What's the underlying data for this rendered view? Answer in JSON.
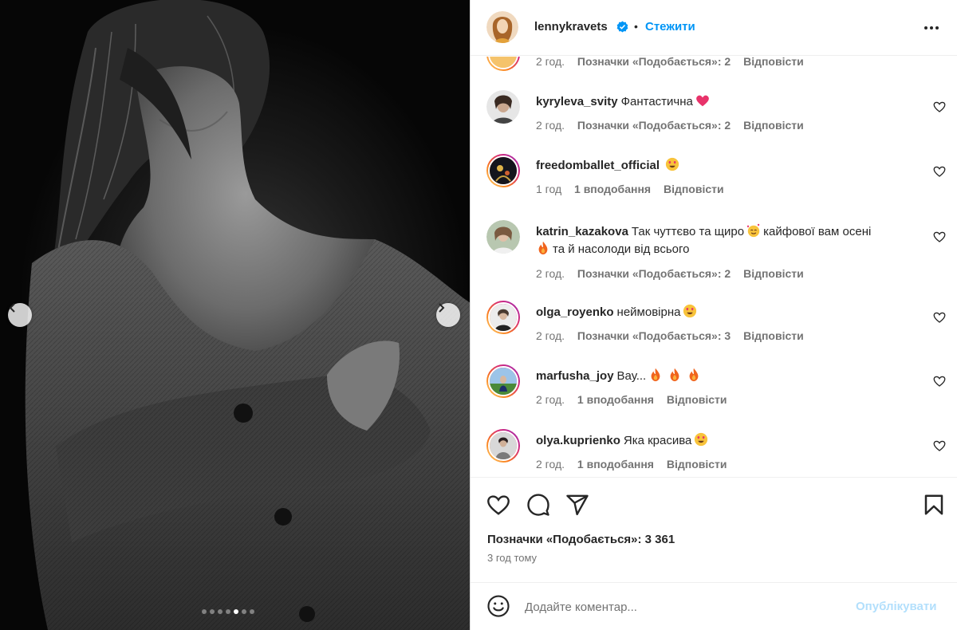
{
  "post": {
    "author": "lennykravets",
    "verified": true,
    "separator": "•",
    "follow_label": "Стежити",
    "more_icon": "more-horizontal-icon",
    "carousel": {
      "total_slides": 7,
      "active_slide": 5
    }
  },
  "comments": [
    {
      "username": "",
      "text": "",
      "time": "2 год.",
      "likes": "Позначки «Подобається»: 2",
      "reply": "Відповісти"
    },
    {
      "username": "kyryleva_svity",
      "text": "Фантастична",
      "emoji": "heart",
      "time": "2 год.",
      "likes": "Позначки «Подобається»: 2",
      "reply": "Відповісти"
    },
    {
      "username": "freedomballet_official",
      "text": "",
      "emoji": "heart-eyes",
      "time": "1 год",
      "likes": "1 вподобання",
      "reply": "Відповісти"
    },
    {
      "username": "katrin_kazakova",
      "text_part1": "Так чуттєво та щиро",
      "text_part2": "кайфової вам осені",
      "text_part3": "та й насолоди від всього",
      "time": "2 год.",
      "likes": "Позначки «Подобається»: 2",
      "reply": "Відповісти"
    },
    {
      "username": "olga_royenko",
      "text": "неймовірна",
      "emoji": "heart-eyes",
      "time": "2 год.",
      "likes": "Позначки «Подобається»: 3",
      "reply": "Відповісти"
    },
    {
      "username": "marfusha_joy",
      "text": "Вау...",
      "emoji": "fire",
      "time": "2 год.",
      "likes": "1 вподобання",
      "reply": "Відповісти"
    },
    {
      "username": "olya.kuprienko",
      "text": "Яка красива",
      "emoji": "heart-eyes",
      "time": "2 год.",
      "likes": "1 вподобання",
      "reply": "Відповісти"
    }
  ],
  "actions": {
    "likes_text": "Позначки «Подобається»: 3 361",
    "posted_time": "3 год тому"
  },
  "add_comment": {
    "placeholder": "Додайте коментар...",
    "publish_label": "Опублікувати"
  },
  "colors": {
    "accent": "#0095f6",
    "publish_disabled": "#b2dffc",
    "muted_text": "#737373",
    "primary_text": "#262626"
  }
}
